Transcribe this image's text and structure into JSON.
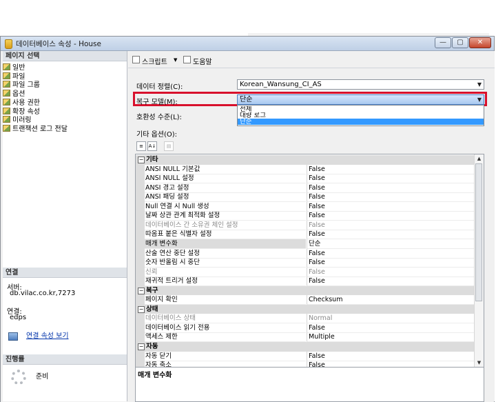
{
  "window": {
    "title": "데이터베이스 속성 - House",
    "min_label": "—",
    "max_label": "▢",
    "close_label": "✕"
  },
  "left": {
    "page_select_header": "페이지 선택",
    "pages": [
      "일반",
      "파일",
      "파일 그룹",
      "옵션",
      "사용 권한",
      "확장 속성",
      "미러링",
      "트랜잭션 로그 전달"
    ],
    "connection_header": "연결",
    "server_label": "서버:",
    "server_value": "db.vilac.co.kr,7273",
    "conn_label": "연결:",
    "conn_value": "edps",
    "conn_props_link": "연결 속성 보기",
    "progress_header": "진행률",
    "status": "준비"
  },
  "toolbar": {
    "script_label": "스크립트",
    "script_arrow": "▼",
    "help_label": "도움말"
  },
  "form": {
    "collation_label": "데이터 정렬(C):",
    "collation_value": "Korean_Wansung_CI_AS",
    "recovery_label": "복구 모델(M):",
    "recovery_value": "단순",
    "compat_label": "호환성 수준(L):",
    "other_options_label": "기타 옵션(O):",
    "dropdown_arrow": "▼",
    "recovery_options": [
      "전체",
      "대량 로그",
      "단순"
    ]
  },
  "grid": {
    "toggle_symbol": "⊟",
    "categories": [
      {
        "name": "기타",
        "rows": [
          {
            "name": "ANSI NULL 기본값",
            "value": "False",
            "disabled": false
          },
          {
            "name": "ANSI NULL 설정",
            "value": "False",
            "disabled": false
          },
          {
            "name": "ANSI 경고 설정",
            "value": "False",
            "disabled": false
          },
          {
            "name": "ANSI 패딩 설정",
            "value": "False",
            "disabled": false
          },
          {
            "name": "Null 연결 시 Null 생성",
            "value": "False",
            "disabled": false
          },
          {
            "name": "날짜 상관 관계 최적화 설정",
            "value": "False",
            "disabled": false
          },
          {
            "name": "데이터베이스 간 소유권 체인 설정",
            "value": "False",
            "disabled": true
          },
          {
            "name": "따옴표 붙은 식별자 설정",
            "value": "False",
            "disabled": false
          },
          {
            "name": "매개 변수화",
            "value": "단순",
            "disabled": false,
            "highlight": true
          },
          {
            "name": "산술 연산 중단 설정",
            "value": "False",
            "disabled": false
          },
          {
            "name": "숫자 반올림 시 중단",
            "value": "False",
            "disabled": false
          },
          {
            "name": "신뢰",
            "value": "False",
            "disabled": true
          },
          {
            "name": "재귀적 트리거 설정",
            "value": "False",
            "disabled": false
          }
        ]
      },
      {
        "name": "복구",
        "rows": [
          {
            "name": "페이지 확인",
            "value": "Checksum",
            "disabled": false
          }
        ]
      },
      {
        "name": "상태",
        "rows": [
          {
            "name": "데이터베이스 상태",
            "value": "Normal",
            "disabled": true
          },
          {
            "name": "데이터베이스 읽기 전용",
            "value": "False",
            "disabled": false
          },
          {
            "name": "액세스 제한",
            "value": "Multiple",
            "disabled": false
          }
        ]
      },
      {
        "name": "자동",
        "rows": [
          {
            "name": "자동 닫기",
            "value": "False",
            "disabled": false
          },
          {
            "name": "자동 축소",
            "value": "False",
            "disabled": false
          }
        ]
      }
    ],
    "description_title": "매개 변수화"
  }
}
